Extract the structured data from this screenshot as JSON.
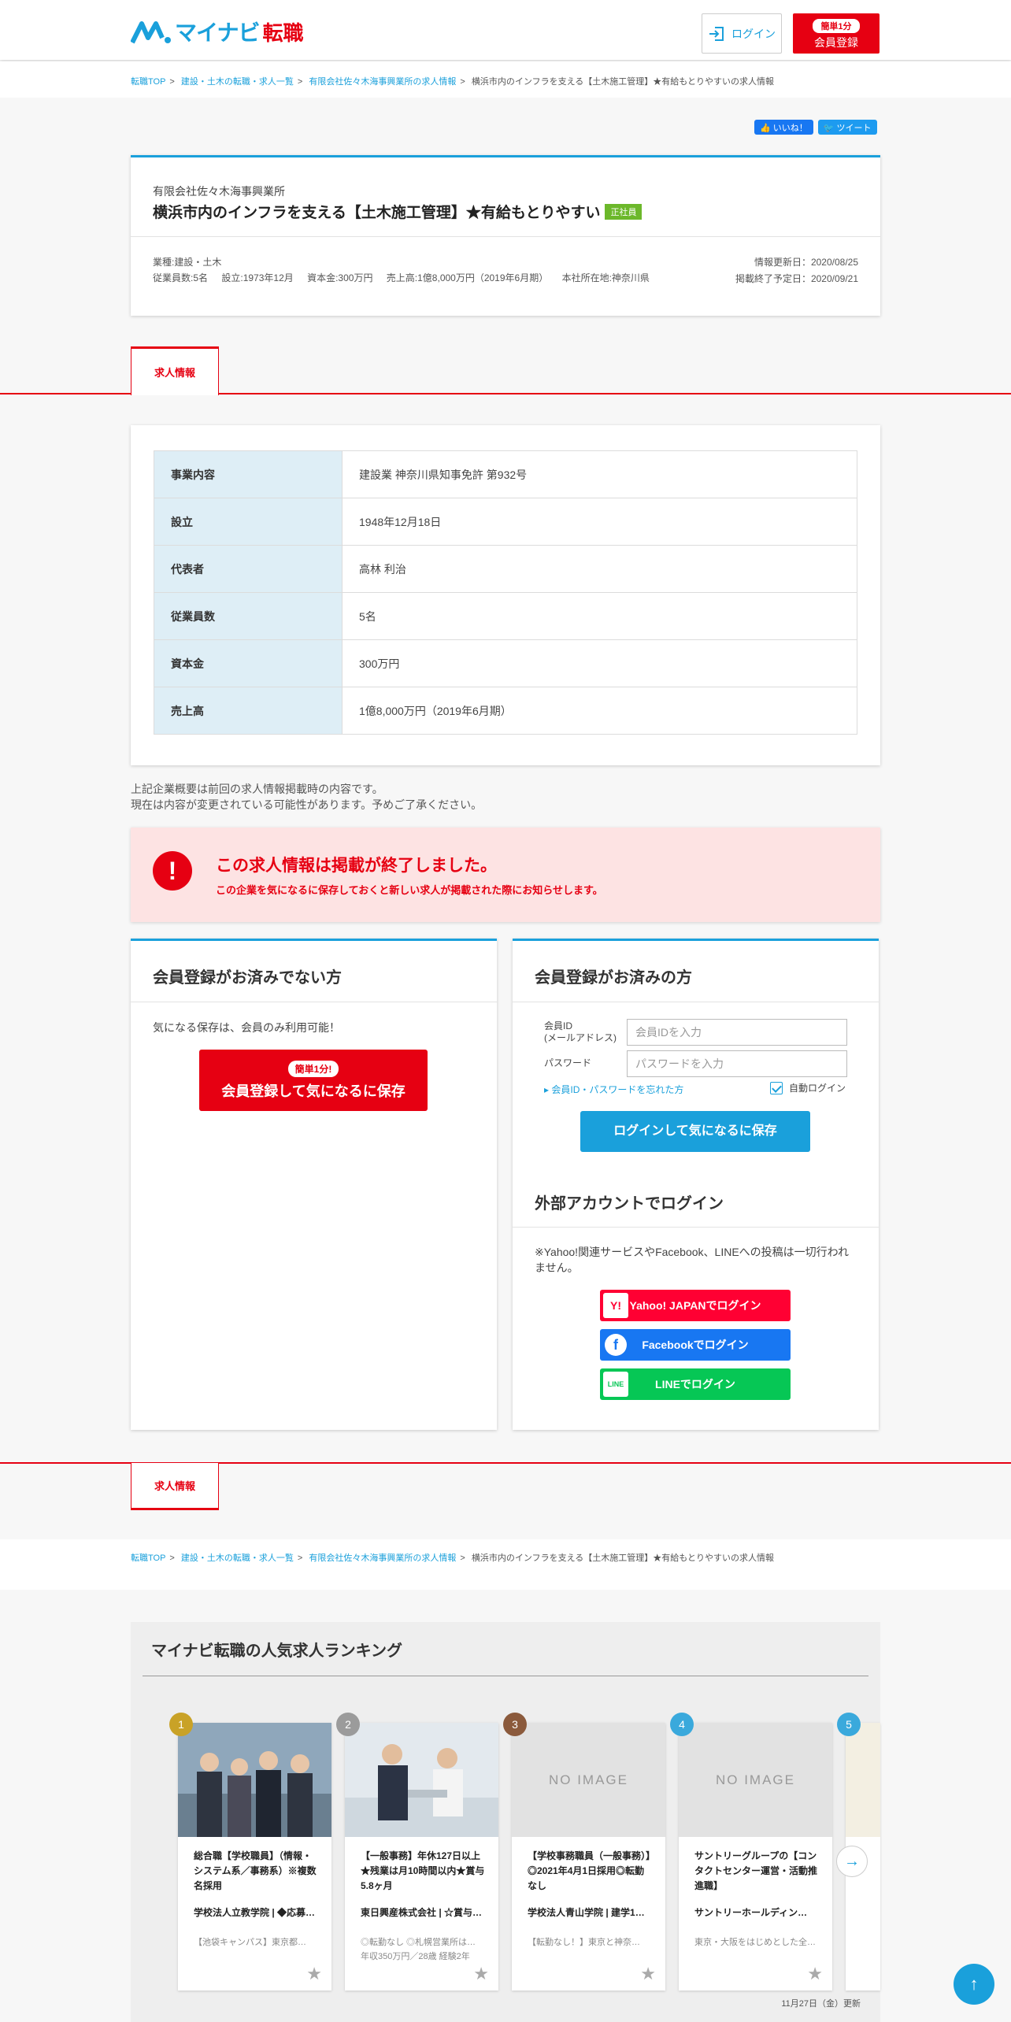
{
  "header": {
    "logo_text": "マイナビ",
    "logo_sub": "転職",
    "login_label": "ログイン",
    "register_pill": "簡単1分",
    "register_label": "会員登録"
  },
  "breadcrumb": [
    "転職TOP",
    "建設・土木の転職・求人一覧",
    "有限会社佐々木海事興業所の求人情報",
    "横浜市内のインフラを支える【土木施工管理】★有給もとりやすいの求人情報"
  ],
  "social": {
    "like": "いいね！",
    "tweet": "ツイート"
  },
  "job": {
    "company": "有限会社佐々木海事興業所",
    "title": "横浜市内のインフラを支える【土木施工管理】★有給もとりやすい",
    "tag": "正社員",
    "industry": "業種:建設・土木",
    "employees": "従業員数:5名",
    "founded": "設立:1973年12月",
    "capital": "資本金:300万円",
    "sales": "売上高:1億8,000万円（2019年6月期）",
    "hq": "本社所在地:神奈川県",
    "updated": "情報更新日：2020/08/25",
    "end": "掲載終了予定日：2020/09/21"
  },
  "tab_label": "求人情報",
  "company_info": [
    {
      "k": "事業内容",
      "v": "建設業 神奈川県知事免許 第932号"
    },
    {
      "k": "設立",
      "v": "1948年12月18日"
    },
    {
      "k": "代表者",
      "v": "高林 利治"
    },
    {
      "k": "従業員数",
      "v": "5名"
    },
    {
      "k": "資本金",
      "v": "300万円"
    },
    {
      "k": "売上高",
      "v": "1億8,000万円（2019年6月期）"
    }
  ],
  "note": [
    "上記企業概要は前回の求人情報掲載時の内容です。",
    "現在は内容が変更されている可能性があります。予めご了承ください。"
  ],
  "alert": {
    "title": "この求人情報は掲載が終了しました。",
    "sub": "この企業を気になるに保存しておくと新しい求人が掲載された際にお知らせします。"
  },
  "guest": {
    "heading": "会員登録がお済みでない方",
    "text": "気になる保存は、会員のみ利用可能！",
    "pill": "簡単1分!",
    "button": "会員登録して気になるに保存"
  },
  "member": {
    "heading": "会員登録がお済みの方",
    "id_label_1": "会員ID",
    "id_label_2": "(メールアドレス)",
    "id_placeholder": "会員IDを入力",
    "pw_label": "パスワード",
    "pw_placeholder": "パスワードを入力",
    "forgot": "▸ 会員ID・パスワードを忘れた方",
    "auto_login": "自動ログイン",
    "login_button": "ログインして気になるに保存",
    "ext_heading": "外部アカウントでログイン",
    "ext_note": "※Yahoo!関連サービスやFacebook、LINEへの投稿は一切行われません。",
    "yahoo": "Yahoo! JAPANでログイン",
    "facebook": "Facebookでログイン",
    "line": "LINEでログイン",
    "yahoo_icon": "Y!",
    "facebook_icon": "f",
    "line_icon": "LINE"
  },
  "ranking": {
    "title": "マイナビ転職の人気求人ランキング",
    "no_image": "NO IMAGE",
    "updated": "11月27日（金）更新",
    "items": [
      {
        "num": "1",
        "title": "総合職【学校職員】（情報・システム系／事務系）※複数名採用",
        "company": "学校法人立教学院 | ◆応募…",
        "desc": "【池袋キャンパス】東京都…",
        "color": "#c9a227"
      },
      {
        "num": "2",
        "title": "【一般事務】年休127日以上★残業は月10時間以内★賞与5.8ヶ月",
        "company": "東日興産株式会社 | ☆賞与…",
        "desc": "◎転勤なし ◎札幌営業所は… 年収350万円／28歳 経験2年",
        "color": "#9b9b9b"
      },
      {
        "num": "3",
        "title": "【学校事務職員（一般事務）】◎2021年4月1日採用◎転勤なし",
        "company": "学校法人青山学院 | 建学1…",
        "desc": "【転勤なし！】東京と神奈…",
        "color": "#8b5a3c"
      },
      {
        "num": "4",
        "title": "サントリーグループの【コンタクトセンター運営・活動推進職】",
        "company": "サントリーホールディン…",
        "desc": "東京・大阪をはじめとした全…",
        "color": "#3aa9dc"
      },
      {
        "num": "5",
        "title": "",
        "company": "",
        "desc": "",
        "color": "#3aa9dc"
      }
    ]
  },
  "colors": {
    "accent": "#1aa0db",
    "brand_red": "#e60012",
    "green_tag": "#6cb82b"
  }
}
